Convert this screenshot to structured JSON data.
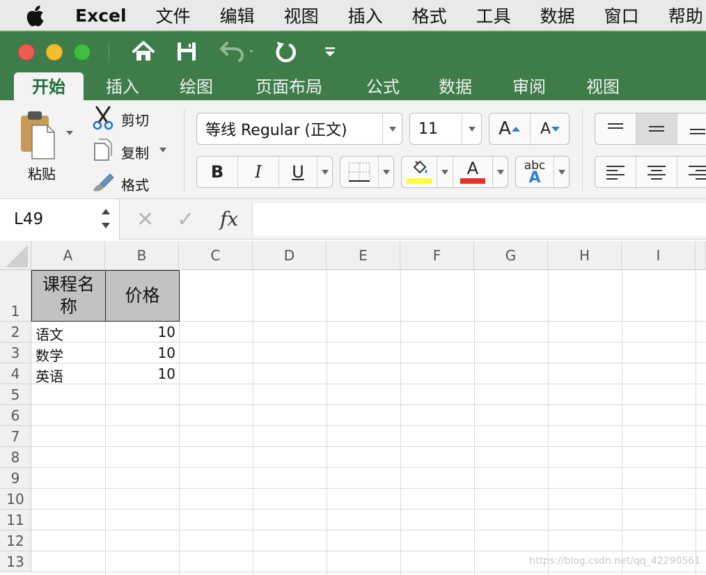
{
  "menubar": {
    "app_name": "Excel",
    "items": [
      "文件",
      "编辑",
      "视图",
      "插入",
      "格式",
      "工具",
      "数据",
      "窗口",
      "帮助"
    ]
  },
  "ribbon_tabs": [
    "开始",
    "插入",
    "绘图",
    "页面布局",
    "公式",
    "数据",
    "审阅",
    "视图"
  ],
  "active_tab": "开始",
  "clipboard": {
    "paste_label": "粘贴",
    "cut_label": "剪切",
    "copy_label": "复制",
    "format_label": "格式"
  },
  "font": {
    "name": "等线 Regular (正文)",
    "size": "11",
    "grow_label": "A",
    "shrink_label": "A",
    "bold_label": "B",
    "italic_label": "I",
    "underline_label": "U",
    "font_color_label": "A",
    "phonetic_label": "abc",
    "phonetic_sub": "A",
    "highlight_color": "#ffff33",
    "font_color": "#e8302a"
  },
  "formula_bar": {
    "cell_ref": "L49",
    "fx_label": "fx",
    "cancel_label": "✕",
    "confirm_label": "✓",
    "value": ""
  },
  "sheet": {
    "columns": [
      "A",
      "B",
      "C",
      "D",
      "E",
      "F",
      "G",
      "H",
      "I"
    ],
    "rows": [
      "1",
      "2",
      "3",
      "4",
      "5",
      "6",
      "7",
      "8",
      "9",
      "10",
      "11",
      "12",
      "13"
    ],
    "header_row": {
      "a1_line1": "课程名",
      "a1_line2": "称",
      "b1": "价格"
    },
    "data_rows": [
      {
        "name": "语文",
        "price": "10"
      },
      {
        "name": "数学",
        "price": "10"
      },
      {
        "name": "英语",
        "price": "10"
      }
    ]
  },
  "watermark": "https://blog.csdn.net/qq_42290561",
  "colors": {
    "title_green": "#3e7c4a",
    "active_tab_text": "#1e6b34",
    "header_fill": "#c2c2c2"
  }
}
